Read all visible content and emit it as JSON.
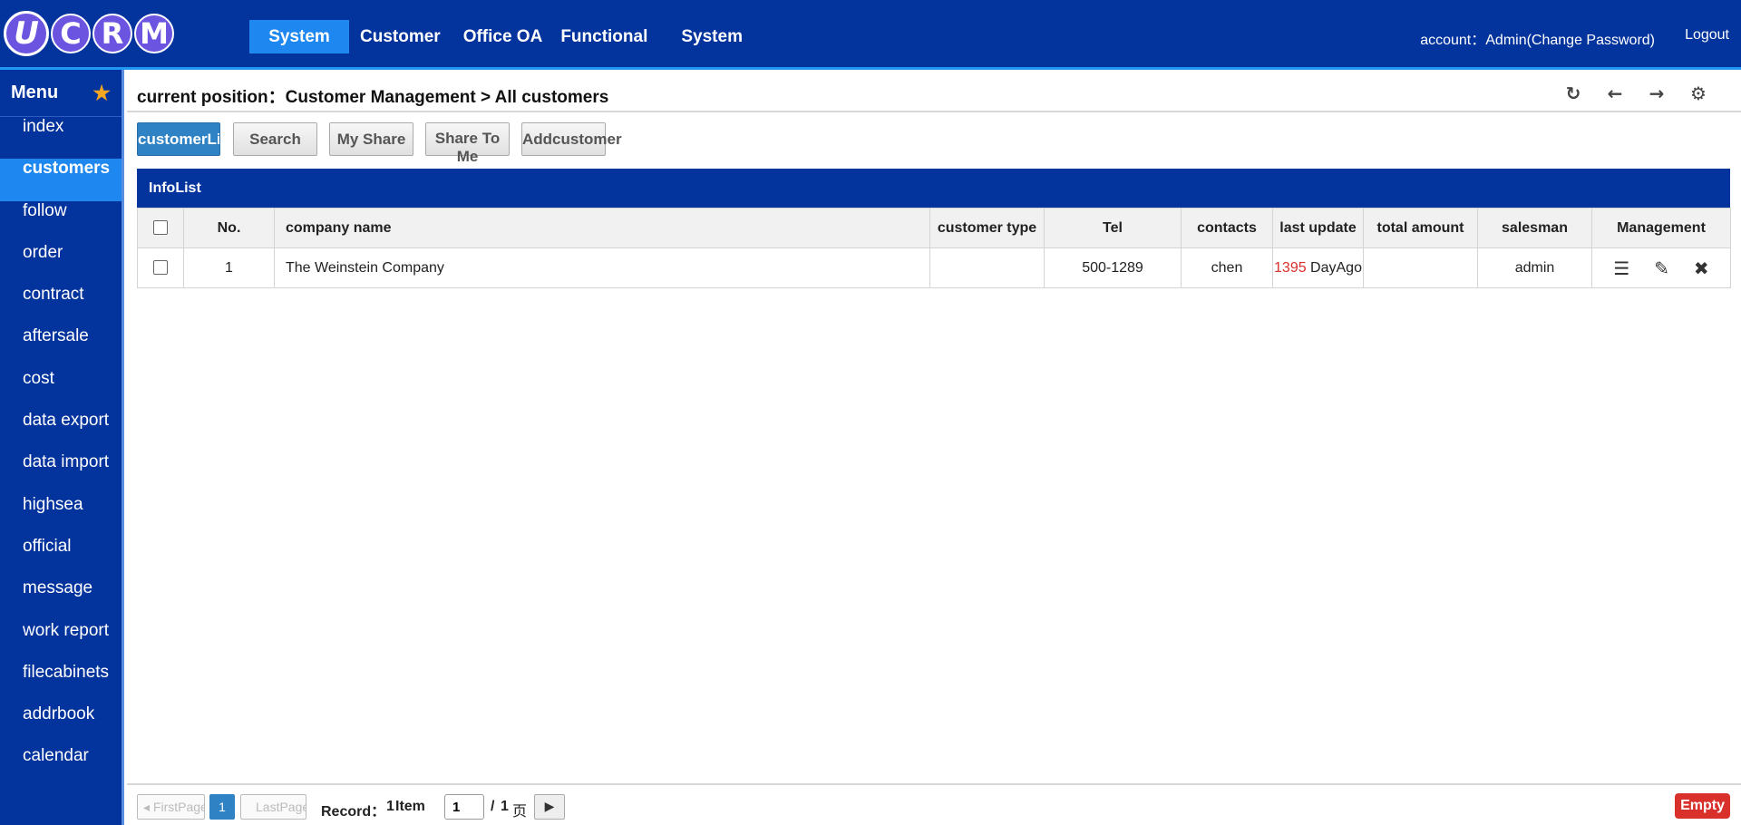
{
  "header": {
    "logo_mark": "U",
    "logo_letters": [
      "C",
      "R",
      "M"
    ],
    "nav": [
      "System",
      "Customer",
      "Office OA",
      "Functional",
      "System"
    ],
    "account": "account：Admin(Change Password)",
    "logout": "Logout"
  },
  "sidebar": {
    "title": "Menu",
    "star": "★",
    "items": [
      "index",
      "customers",
      "follow",
      "order",
      "contract",
      "aftersale",
      "cost",
      "data export",
      "data import",
      "highsea",
      "official",
      "message",
      "work report",
      "filecabinets",
      "addrbook",
      "calendar"
    ]
  },
  "position": {
    "text": "current position：Customer Management > All customers",
    "icons": [
      "refresh-icon",
      "arrow-left-icon",
      "arrow-right-icon",
      "gear-icon"
    ]
  },
  "buttons": [
    "customerList",
    "Search",
    "My Share",
    "Share To Me",
    "Addcustomer"
  ],
  "table": {
    "title": "InfoList",
    "headers": [
      "No.",
      "company name",
      "customer type",
      "Tel",
      "contacts",
      "last update",
      "total amount",
      "salesman",
      "Management"
    ],
    "rows": [
      {
        "no": "1",
        "company": "The Weinstein Company",
        "type": "",
        "tel": "500-1289",
        "contacts": "chen",
        "days": "1395",
        "days_suffix": " DayAgo",
        "total": "",
        "salesman": "admin"
      }
    ],
    "management_icons": [
      "list-icon",
      "pencil-icon",
      "close-icon"
    ]
  },
  "footer": {
    "first": "◂ FirstPage",
    "page": "1",
    "last": "LastPage ▸",
    "record_label": "Record：",
    "record_count": "1",
    "record_unit": " Item",
    "page_input": "1",
    "slash": "/",
    "total_pages": "1",
    "page_unit": "页",
    "go": "▶",
    "empty": "Empty"
  },
  "colors": {
    "primary_blue": "#03339c",
    "accent_blue": "#1e88f0",
    "danger_red": "#d9302b"
  }
}
